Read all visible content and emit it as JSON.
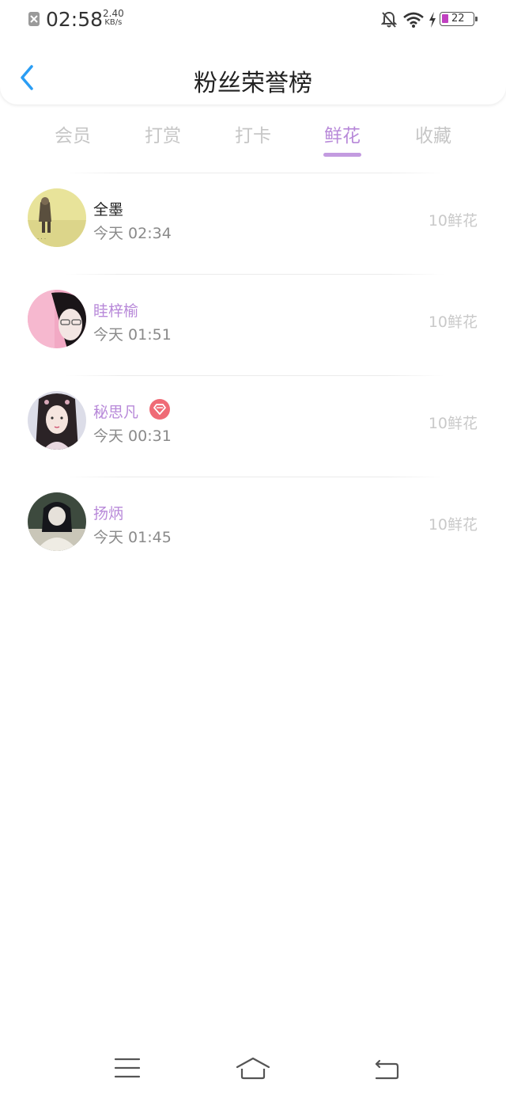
{
  "status_bar": {
    "time": "02:58",
    "speed_value": "2.40",
    "speed_unit": "KB/s",
    "battery": "22",
    "battery_level": 0.22,
    "icons": [
      "close-notification-icon",
      "bell-off-icon",
      "wifi-icon",
      "charging-icon",
      "battery-icon"
    ]
  },
  "header": {
    "back_icon": "chevron-left-icon",
    "title": "粉丝荣誉榜"
  },
  "tabs": [
    {
      "label": "会员",
      "active": false
    },
    {
      "label": "打赏",
      "active": false
    },
    {
      "label": "打卡",
      "active": false
    },
    {
      "label": "鲜花",
      "active": true
    },
    {
      "label": "收藏",
      "active": false
    }
  ],
  "list": [
    {
      "name": "全墨",
      "time": "今天 02:34",
      "amount": "10鲜花",
      "name_color": "#222222",
      "badge": null
    },
    {
      "name": "眭梓榆",
      "time": "今天 01:51",
      "amount": "10鲜花",
      "name_color": "#b889d9",
      "badge": null
    },
    {
      "name": "秘思凡",
      "time": "今天 00:31",
      "amount": "10鲜花",
      "name_color": "#b889d9",
      "badge": "diamond-vip-icon"
    },
    {
      "name": "扬炳",
      "time": "今天 01:45",
      "amount": "10鲜花",
      "name_color": "#b889d9",
      "badge": null
    }
  ],
  "bottom_nav": {
    "icons": [
      "menu-icon",
      "home-icon",
      "back-icon"
    ]
  },
  "colors": {
    "accent": "#b889d9",
    "back_arrow": "#2a9df4",
    "tab_inactive": "#c6c6c6",
    "amount": "#c9c9c9",
    "vip_badge": "#ef6b76"
  }
}
